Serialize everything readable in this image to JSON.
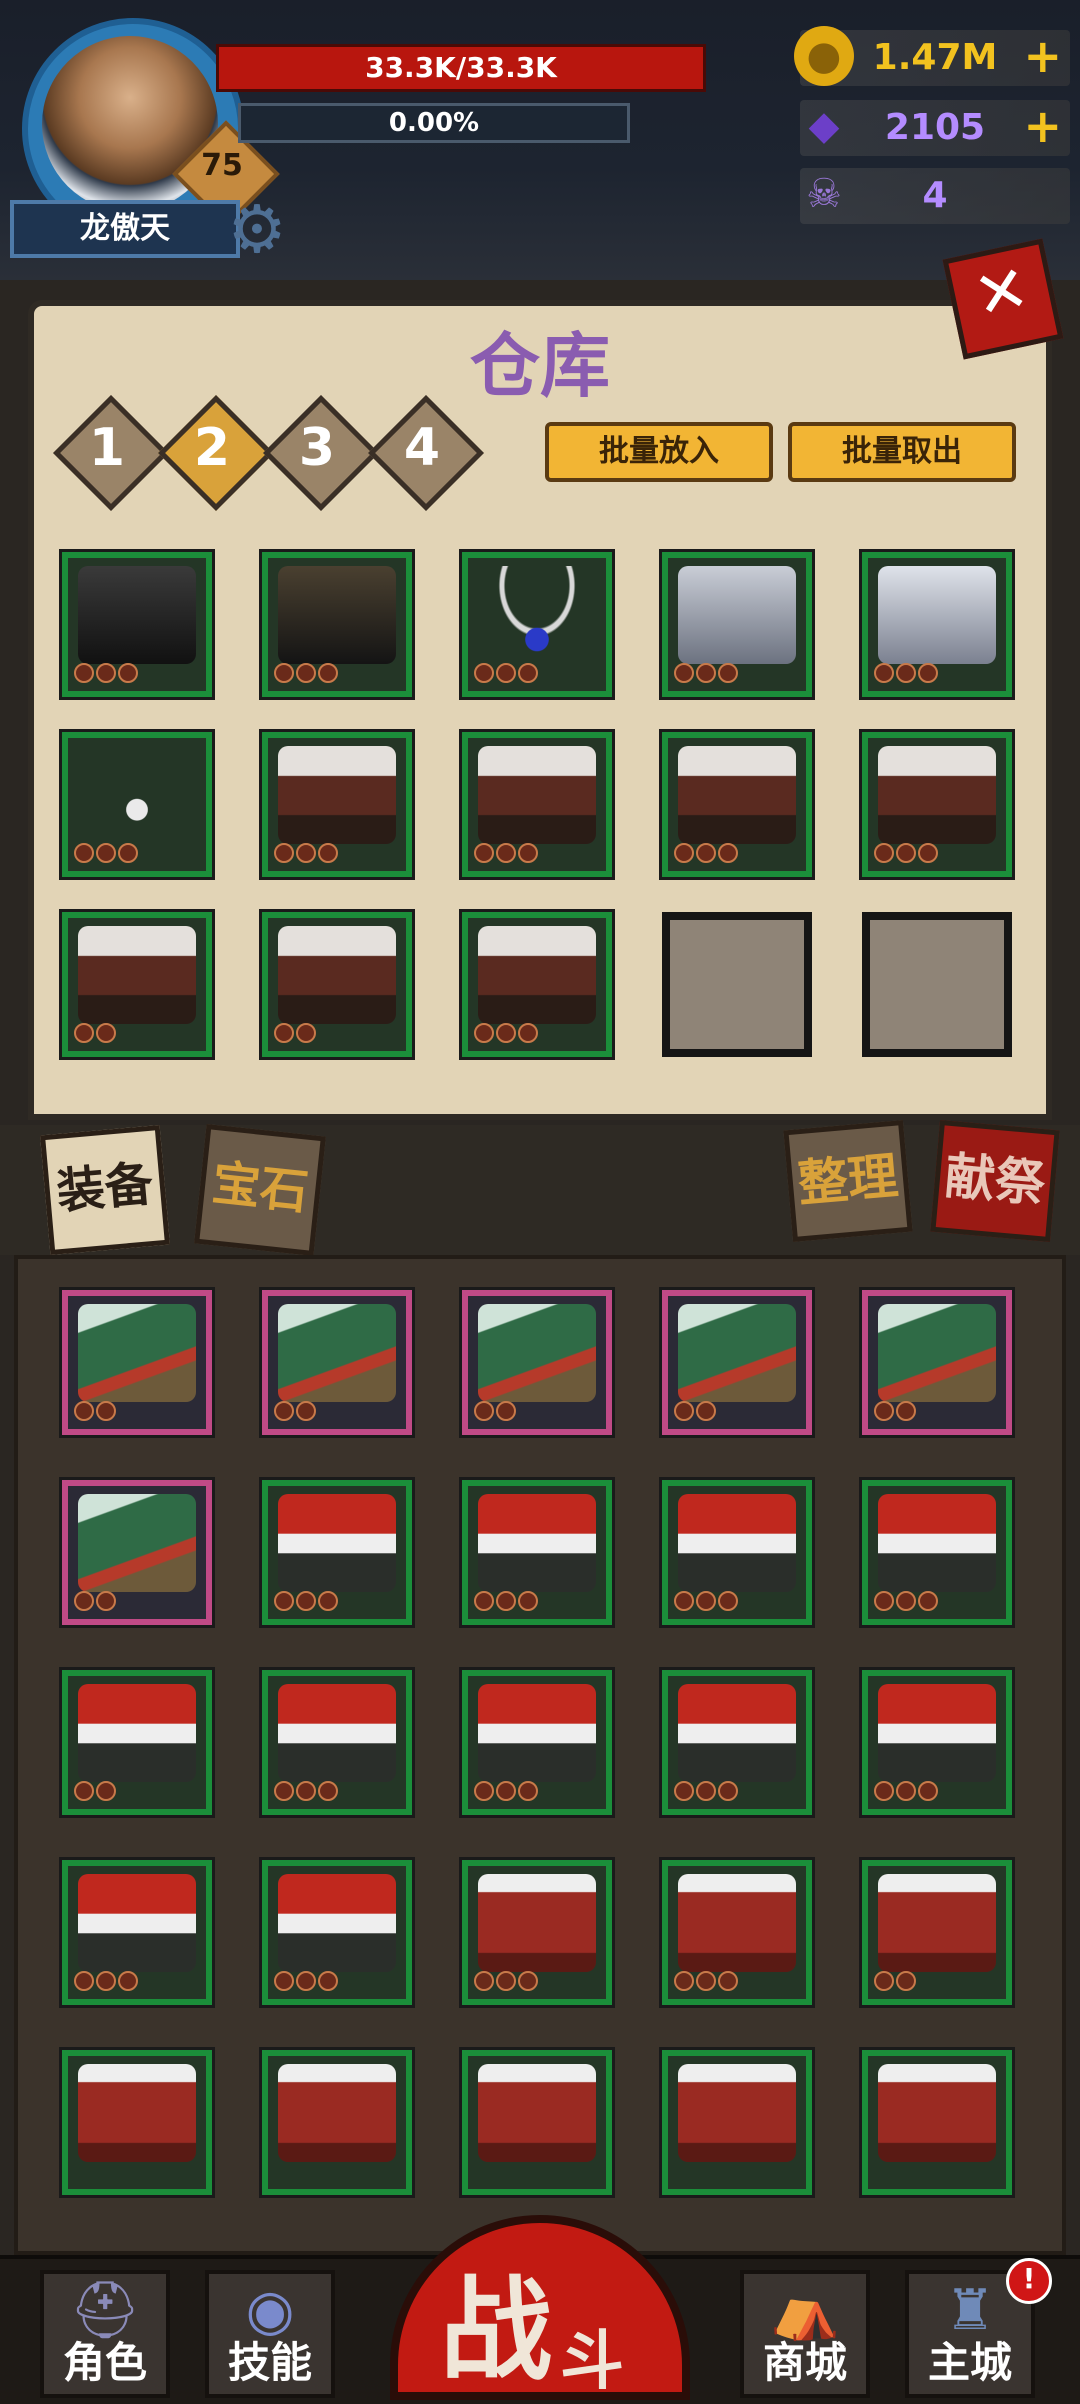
{
  "player": {
    "name": "龙傲天",
    "level": "75",
    "hp_text": "33.3K/33.3K",
    "xp_text": "0.00%"
  },
  "resources": [
    {
      "icon": "gold-coin-icon",
      "value": "1.47M",
      "plus": "+",
      "color": "#f2c21f"
    },
    {
      "icon": "purple-gem-icon",
      "value": "2105",
      "plus": "+",
      "color": "#b48cff"
    },
    {
      "icon": "ram-skull-icon",
      "value": "4",
      "plus": "",
      "color": "#b48cff"
    }
  ],
  "warehouse": {
    "title": "仓库",
    "close_label": "✕",
    "pages": [
      "1",
      "2",
      "3",
      "4"
    ],
    "active_page": "2",
    "batch_put_label": "批量放入",
    "batch_take_label": "批量取出",
    "items": [
      {
        "icon": "black-trousers-icon",
        "rarity": "green",
        "stars": 3
      },
      {
        "icon": "black-coat-icon",
        "rarity": "green",
        "stars": 3
      },
      {
        "icon": "pearl-necklace-icon",
        "rarity": "green",
        "stars": 3
      },
      {
        "icon": "steel-helmet-icon",
        "rarity": "green",
        "stars": 3
      },
      {
        "icon": "plate-armor-icon",
        "rarity": "green",
        "stars": 3
      },
      {
        "icon": "triangle-pendant-icon",
        "rarity": "green",
        "stars": 3
      },
      {
        "icon": "fur-boots-icon",
        "rarity": "green",
        "stars": 3
      },
      {
        "icon": "fur-boots-icon",
        "rarity": "green",
        "stars": 3
      },
      {
        "icon": "fur-boots-icon",
        "rarity": "green",
        "stars": 3
      },
      {
        "icon": "fur-boots-icon",
        "rarity": "green",
        "stars": 3
      },
      {
        "icon": "fur-boots-icon",
        "rarity": "green",
        "stars": 2
      },
      {
        "icon": "fur-boots-icon",
        "rarity": "green",
        "stars": 2
      },
      {
        "icon": "fur-boots-icon",
        "rarity": "green",
        "stars": 3
      },
      {
        "icon": "",
        "rarity": "empty",
        "stars": 0
      },
      {
        "icon": "",
        "rarity": "empty",
        "stars": 0
      }
    ]
  },
  "bag": {
    "tabs": [
      {
        "label": "装备",
        "active": true
      },
      {
        "label": "宝石",
        "active": false
      }
    ],
    "sort_label": "整理",
    "sacrifice_label": "献祭",
    "items": [
      {
        "icon": "christmas-tree-icon",
        "rarity": "epic",
        "stars": 2
      },
      {
        "icon": "christmas-tree-icon",
        "rarity": "epic",
        "stars": 2
      },
      {
        "icon": "christmas-tree-icon",
        "rarity": "epic",
        "stars": 2
      },
      {
        "icon": "christmas-tree-icon",
        "rarity": "epic",
        "stars": 2
      },
      {
        "icon": "christmas-tree-icon",
        "rarity": "epic",
        "stars": 2
      },
      {
        "icon": "christmas-tree-icon",
        "rarity": "epic",
        "stars": 2
      },
      {
        "icon": "santa-hat-icon",
        "rarity": "green",
        "stars": 3
      },
      {
        "icon": "santa-hat-icon",
        "rarity": "green",
        "stars": 3
      },
      {
        "icon": "santa-hat-icon",
        "rarity": "green",
        "stars": 3
      },
      {
        "icon": "santa-hat-icon",
        "rarity": "green",
        "stars": 3
      },
      {
        "icon": "santa-hat-icon",
        "rarity": "green",
        "stars": 2
      },
      {
        "icon": "santa-hat-icon",
        "rarity": "green",
        "stars": 3
      },
      {
        "icon": "santa-hat-icon",
        "rarity": "green",
        "stars": 3
      },
      {
        "icon": "santa-hat-icon",
        "rarity": "green",
        "stars": 3
      },
      {
        "icon": "santa-hat-icon",
        "rarity": "green",
        "stars": 3
      },
      {
        "icon": "santa-hat-icon",
        "rarity": "green",
        "stars": 3
      },
      {
        "icon": "santa-hat-icon",
        "rarity": "green",
        "stars": 3
      },
      {
        "icon": "santa-coat-icon",
        "rarity": "green",
        "stars": 3
      },
      {
        "icon": "santa-coat-icon",
        "rarity": "green",
        "stars": 3
      },
      {
        "icon": "santa-coat-icon",
        "rarity": "green",
        "stars": 2
      },
      {
        "icon": "santa-coat-icon",
        "rarity": "green",
        "stars": 0
      },
      {
        "icon": "santa-coat-icon",
        "rarity": "green",
        "stars": 0
      },
      {
        "icon": "santa-coat-icon",
        "rarity": "green",
        "stars": 0
      },
      {
        "icon": "santa-coat-icon",
        "rarity": "green",
        "stars": 0
      },
      {
        "icon": "santa-coat-icon",
        "rarity": "green",
        "stars": 0
      }
    ]
  },
  "nav": {
    "character_label": "角色",
    "skills_label": "技能",
    "battle_main": "战",
    "battle_sub": "斗",
    "shop_label": "商城",
    "castle_label": "主城",
    "alert_label": "!"
  },
  "colors": {
    "green_frame": "#1b8e3a",
    "epic_frame": "#c04a86",
    "gold": "#f2b534",
    "red": "#c21a12",
    "title_purple": "#8a5cb0"
  }
}
